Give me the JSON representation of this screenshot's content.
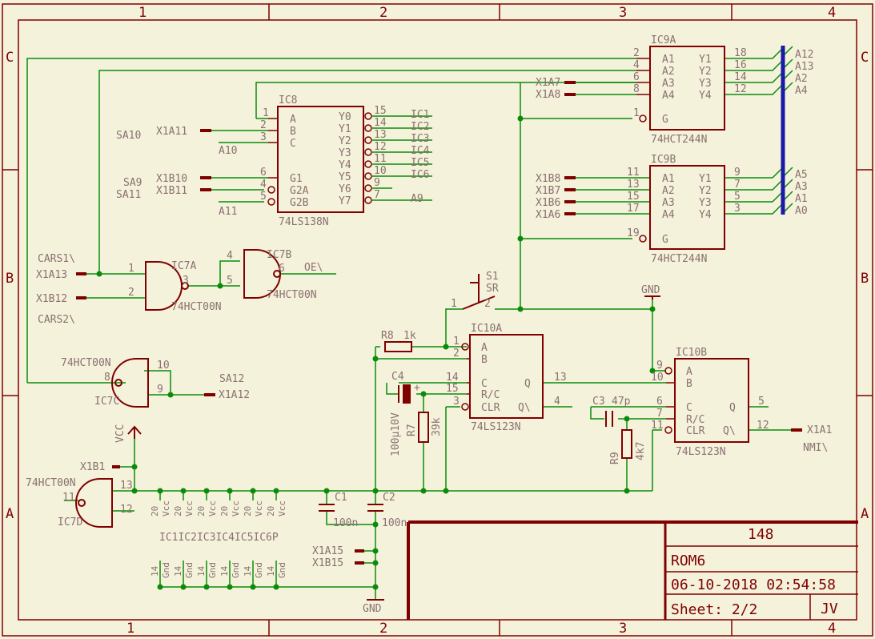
{
  "colors": {
    "background": "#f5f2dc",
    "frame": "#800000",
    "wire": "#0a8c0a",
    "bus": "#1a1aa6",
    "text": "#8a7070",
    "label": "#800000",
    "junction": "#0a8c0a"
  },
  "frame": {
    "columns": [
      "1",
      "2",
      "3",
      "4"
    ],
    "rows": [
      "C",
      "B",
      "A"
    ]
  },
  "title_block": {
    "number": "148",
    "name": "ROM6",
    "datetime": "06-10-2018 02:54:58",
    "sheet": "Sheet: 2/2",
    "author": "JV"
  },
  "parts": {
    "ic8": {
      "name": "IC8",
      "type": "74LS138N",
      "inputs": [
        {
          "pin": "1",
          "label": "A"
        },
        {
          "pin": "2",
          "label": "B"
        },
        {
          "pin": "3",
          "label": "C"
        },
        {
          "pin": "6",
          "label": "G1"
        },
        {
          "pin": "4",
          "label": "G2A"
        },
        {
          "pin": "5",
          "label": "G2B"
        }
      ],
      "outputs": [
        {
          "pin": "15",
          "label": "Y0",
          "net": "IC1"
        },
        {
          "pin": "14",
          "label": "Y1",
          "net": "IC2"
        },
        {
          "pin": "13",
          "label": "Y2",
          "net": "IC3"
        },
        {
          "pin": "12",
          "label": "Y3",
          "net": "IC4"
        },
        {
          "pin": "11",
          "label": "Y4",
          "net": "IC5"
        },
        {
          "pin": "10",
          "label": "Y5",
          "net": "IC6"
        },
        {
          "pin": "9",
          "label": "Y6",
          "net": ""
        },
        {
          "pin": "7",
          "label": "Y7",
          "net": "A9"
        }
      ]
    },
    "ic9a": {
      "name": "IC9A",
      "type": "74HCT244N",
      "inputs": [
        {
          "pin": "2",
          "label": "A1"
        },
        {
          "pin": "4",
          "label": "A2"
        },
        {
          "pin": "6",
          "label": "A3"
        },
        {
          "pin": "8",
          "label": "A4"
        },
        {
          "pin": "1",
          "label": "G"
        }
      ],
      "outputs": [
        {
          "pin": "18",
          "label": "Y1",
          "net": "A12"
        },
        {
          "pin": "16",
          "label": "Y2",
          "net": "A13"
        },
        {
          "pin": "14",
          "label": "Y3",
          "net": "A2"
        },
        {
          "pin": "12",
          "label": "Y4",
          "net": "A4"
        }
      ]
    },
    "ic9b": {
      "name": "IC9B",
      "type": "74HCT244N",
      "inputs": [
        {
          "pin": "11",
          "label": "A1"
        },
        {
          "pin": "13",
          "label": "A2"
        },
        {
          "pin": "15",
          "label": "A3"
        },
        {
          "pin": "17",
          "label": "A4"
        },
        {
          "pin": "19",
          "label": "G"
        }
      ],
      "outputs": [
        {
          "pin": "9",
          "label": "Y1",
          "net": "A5"
        },
        {
          "pin": "7",
          "label": "Y2",
          "net": "A3"
        },
        {
          "pin": "5",
          "label": "Y3",
          "net": "A1"
        },
        {
          "pin": "3",
          "label": "Y4",
          "net": "A0"
        }
      ]
    },
    "ic10a": {
      "name": "IC10A",
      "type": "74LS123N",
      "inputs": [
        {
          "pin": "1",
          "label": "A"
        },
        {
          "pin": "2",
          "label": "B"
        },
        {
          "pin": "14",
          "label": "C"
        },
        {
          "pin": "15",
          "label": "R/C"
        },
        {
          "pin": "3",
          "label": "CLR"
        }
      ],
      "outputs": [
        {
          "pin": "13",
          "label": "Q"
        },
        {
          "pin": "4",
          "label": "Q\\"
        }
      ]
    },
    "ic10b": {
      "name": "IC10B",
      "type": "74LS123N",
      "inputs": [
        {
          "pin": "9",
          "label": "A"
        },
        {
          "pin": "10",
          "label": "B"
        },
        {
          "pin": "6",
          "label": "C"
        },
        {
          "pin": "7",
          "label": "R/C"
        },
        {
          "pin": "11",
          "label": "CLR"
        }
      ],
      "outputs": [
        {
          "pin": "5",
          "label": "Q"
        },
        {
          "pin": "12",
          "label": "Q\\"
        }
      ]
    },
    "ic7a": {
      "name": "IC7A",
      "type": "74HCT00N",
      "pins": [
        "1",
        "2",
        "3"
      ]
    },
    "ic7b": {
      "name": "IC7B",
      "pins": [
        "4",
        "5",
        "6"
      ]
    },
    "ic7c": {
      "name": "IC7C",
      "type": "74HCT00N",
      "pins": [
        "8",
        "10",
        "9"
      ]
    },
    "ic7d": {
      "name": "IC7D",
      "type": "74HCT00N",
      "pins": [
        "13",
        "12",
        "11"
      ]
    },
    "r8": {
      "name": "R8",
      "value": "1k"
    },
    "r7": {
      "name": "R7",
      "value": "39k"
    },
    "r9": {
      "name": "R9",
      "value": "4k7"
    },
    "c4": {
      "name": "C4",
      "value": "100µ10V"
    },
    "c3": {
      "name": "C3",
      "value": "47p"
    },
    "c1": {
      "name": "C1",
      "value": "100n"
    },
    "c2": {
      "name": "C2",
      "value": "100n"
    },
    "s1": {
      "name": "S1",
      "value": "SR",
      "pins": [
        "1",
        "2"
      ]
    }
  },
  "net_labels": {
    "sa10": "SA10",
    "x1a11": "X1A11",
    "a10": "A10",
    "sa9": "SA9",
    "sa11": "SA11",
    "x1b10": "X1B10",
    "x1b11": "X1B11",
    "a11": "A11",
    "x1a7": "X1A7",
    "x1a8": "X1A8",
    "x1b8": "X1B8",
    "x1b7": "X1B7",
    "x1b6": "X1B6",
    "x1a6": "X1A6",
    "cars1": "CARS1\\",
    "x1a13": "X1A13",
    "x1b12": "X1B12",
    "cars2": "CARS2\\",
    "oe": "OE\\",
    "sa12": "SA12",
    "x1a12": "X1A12",
    "x1b1": "X1B1",
    "vcc": "VCC",
    "gnd_top": "GND",
    "gnd_bottom": "GND",
    "x1a1": "X1A1",
    "nmi": "NMI\\",
    "x1a15": "X1A15",
    "x1b15": "X1B15"
  },
  "power_pins": {
    "vcc_pin": "20",
    "vcc_label": "Vcc",
    "gnd_pin": "14",
    "gnd_label": "Gnd",
    "names": [
      "IC1",
      "IC2",
      "IC3",
      "IC4",
      "IC5",
      "IC6"
    ],
    "names_label": "IC1IC2IC3IC4IC5IC6P"
  }
}
